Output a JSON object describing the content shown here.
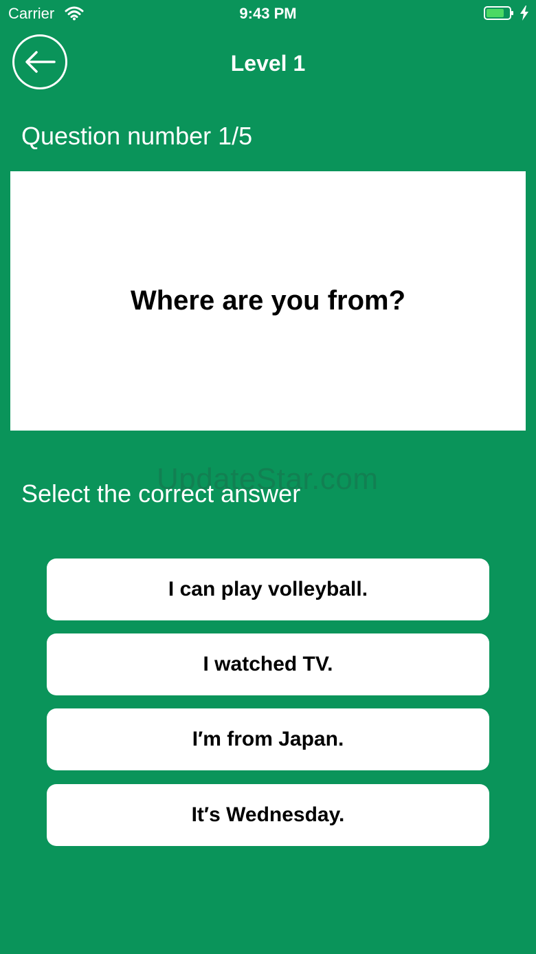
{
  "status_bar": {
    "carrier": "Carrier",
    "time": "9:43 PM",
    "battery_color": "#4cd964"
  },
  "header": {
    "title": "Level 1",
    "back_icon": "arrow-left-icon"
  },
  "quiz": {
    "question_number": "Question number 1/5",
    "question": "Where are you from?",
    "prompt": "Select the correct answer",
    "answers": [
      "I can play volleyball.",
      "I watched TV.",
      "I′m from Japan.",
      "It′s Wednesday."
    ]
  },
  "watermark": "UpdateStar.com",
  "colors": {
    "background": "#0a945a",
    "card": "#ffffff"
  }
}
